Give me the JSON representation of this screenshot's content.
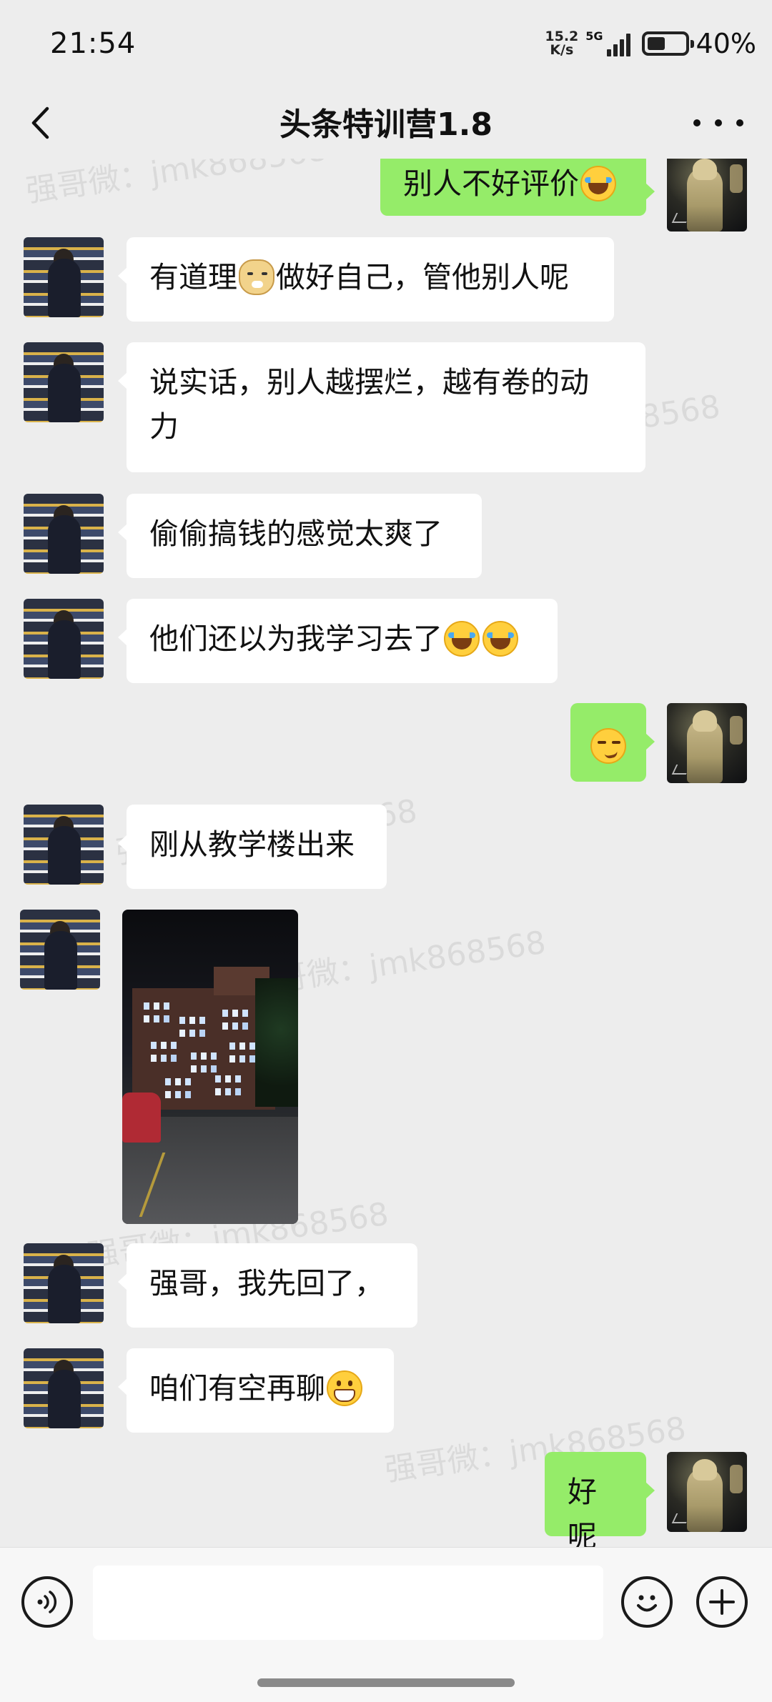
{
  "status_bar": {
    "time": "21:54",
    "net_speed_value": "15.2",
    "net_speed_unit": "K/s",
    "network_type": "5G",
    "battery": "40%"
  },
  "header": {
    "title": "头条特训营1.8",
    "back_icon": "chevron-left-icon",
    "more_icon": "more-dots-icon"
  },
  "watermark_text": "强哥微：jmk868568",
  "messages": [
    {
      "from": "me",
      "text": "别人不好评价",
      "emoji": "laugh-tears"
    },
    {
      "from": "them",
      "text_before": "有道理",
      "emoji": "doge",
      "text_after": "做好自己，管他别人呢"
    },
    {
      "from": "them",
      "line1": "说实话，别人越摆烂，越有卷的动",
      "line2": "力"
    },
    {
      "from": "them",
      "text": "偷偷搞钱的感觉太爽了"
    },
    {
      "from": "them",
      "text": "他们还以为我学习去了",
      "emoji": "laugh-tears"
    },
    {
      "from": "me",
      "emoji": "smirk"
    },
    {
      "from": "them",
      "text": "刚从教学楼出来"
    },
    {
      "from": "them",
      "type": "image",
      "content": "night-campus-building-photo"
    },
    {
      "from": "them",
      "text": "强哥，我先回了，"
    },
    {
      "from": "them",
      "text": "咱们有空再聊",
      "emoji": "grin"
    },
    {
      "from": "me",
      "text": "好呢"
    }
  ],
  "input_bar": {
    "voice_icon": "voice-icon",
    "emoji_icon": "smiley-icon",
    "plus_icon": "plus-icon",
    "input_value": ""
  },
  "colors": {
    "background": "#ededed",
    "my_bubble": "#95ec69",
    "their_bubble": "#ffffff"
  }
}
